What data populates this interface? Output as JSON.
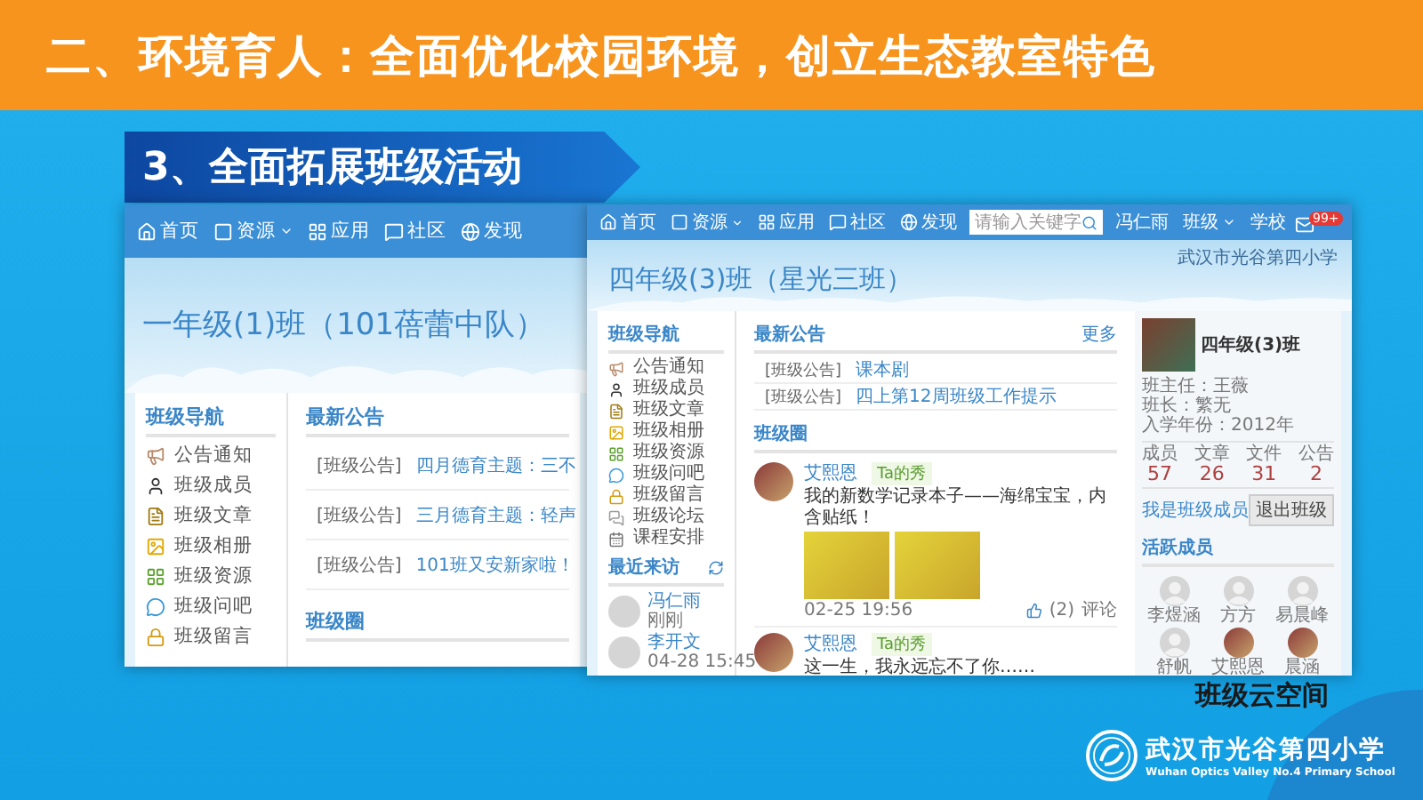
{
  "slide_title": "二、环境育人：全面优化校园环境，创立生态教室特色",
  "section_banner": "3、全面拓展班级活动",
  "left_window": {
    "nav": [
      {
        "kind": "home",
        "label": "首页",
        "dropdown": false
      },
      {
        "kind": "resource",
        "label": "资源",
        "dropdown": true
      },
      {
        "kind": "apps",
        "label": "应用",
        "dropdown": false
      },
      {
        "kind": "community",
        "label": "社区",
        "dropdown": false
      },
      {
        "kind": "discover",
        "label": "发现",
        "dropdown": false
      }
    ],
    "class_title": "一年级(1)班（101蓓蕾中队）",
    "nav_title": "班级导航",
    "nav_items": [
      {
        "kind": "notice",
        "label": "公告通知"
      },
      {
        "kind": "members",
        "label": "班级成员"
      },
      {
        "kind": "articles",
        "label": "班级文章"
      },
      {
        "kind": "album",
        "label": "班级相册"
      },
      {
        "kind": "resources",
        "label": "班级资源"
      },
      {
        "kind": "qa",
        "label": "班级问吧"
      },
      {
        "kind": "messages",
        "label": "班级留言"
      }
    ],
    "announcements_title": "最新公告",
    "announcements": [
      {
        "tag": "[班级公告]",
        "text": "四月德育主题：三不"
      },
      {
        "tag": "[班级公告]",
        "text": "三月德育主题：轻声"
      },
      {
        "tag": "[班级公告]",
        "text": "101班又安新家啦！"
      }
    ],
    "circle_title": "班级圈"
  },
  "right_window": {
    "nav": [
      {
        "kind": "home",
        "label": "首页",
        "dropdown": false
      },
      {
        "kind": "resource",
        "label": "资源",
        "dropdown": true
      },
      {
        "kind": "apps",
        "label": "应用",
        "dropdown": false
      },
      {
        "kind": "community",
        "label": "社区",
        "dropdown": false
      },
      {
        "kind": "discover",
        "label": "发现",
        "dropdown": false
      }
    ],
    "search": {
      "placeholder": "请输入关键字"
    },
    "user_links": [
      {
        "label": "冯仁雨",
        "dropdown": false
      },
      {
        "label": "班级",
        "dropdown": true
      },
      {
        "label": "学校",
        "dropdown": false
      }
    ],
    "mail_badge": "99+",
    "school_name": "武汉市光谷第四小学",
    "class_title": "四年级(3)班（星光三班）",
    "nav_title": "班级导航",
    "nav_items": [
      {
        "kind": "notice",
        "label": "公告通知"
      },
      {
        "kind": "members",
        "label": "班级成员"
      },
      {
        "kind": "articles",
        "label": "班级文章"
      },
      {
        "kind": "album",
        "label": "班级相册"
      },
      {
        "kind": "resources",
        "label": "班级资源"
      },
      {
        "kind": "qa",
        "label": "班级问吧"
      },
      {
        "kind": "messages",
        "label": "班级留言"
      },
      {
        "kind": "forum",
        "label": "班级论坛"
      },
      {
        "kind": "schedule",
        "label": "课程安排"
      }
    ],
    "visitors_title": "最近来访",
    "visitors": [
      {
        "name": "冯仁雨",
        "note": "刚刚"
      },
      {
        "name": "李开文",
        "note": "04-28 15:45"
      }
    ],
    "announcements_title": "最新公告",
    "more": "更多",
    "announcements": [
      {
        "tag": "[班级公告]",
        "text": "课本剧"
      },
      {
        "tag": "[班级公告]",
        "text": "四上第12周班级工作提示"
      }
    ],
    "circle_title": "班级圈",
    "posts": [
      {
        "kind": "photos",
        "author": "艾熙恩",
        "tag": "Ta的秀",
        "text": "我的新数学记录本子——海绵宝宝，内含贴纸！",
        "time": "02-25 19:56",
        "likes": "(2)",
        "comment": "评论"
      },
      {
        "kind": "text",
        "author": "艾熙恩",
        "tag": "Ta的秀",
        "text": "这一生，我永远忘不了你……"
      }
    ],
    "profile": {
      "name": "四年级(3)班",
      "lines": [
        "班主任：王薇",
        "班长：繁无",
        "入学年份：2012年"
      ]
    },
    "stats": [
      {
        "label": "成员",
        "value": "57"
      },
      {
        "label": "文章",
        "value": "26"
      },
      {
        "label": "文件",
        "value": "31"
      },
      {
        "label": "公告",
        "value": "2"
      }
    ],
    "member_link": "我是班级成员",
    "quit_button": "退出班级",
    "active_title": "活跃成员",
    "active_members": [
      {
        "kind": "default",
        "name": "李煜涵"
      },
      {
        "kind": "default",
        "name": "方方"
      },
      {
        "kind": "default",
        "name": "易晨峰"
      },
      {
        "kind": "default",
        "name": "舒帆"
      },
      {
        "kind": "photo",
        "name": "艾熙恩"
      },
      {
        "kind": "photo",
        "name": "晨涵"
      }
    ]
  },
  "caption": "班级云空间",
  "school_logo": {
    "name": "武汉市光谷第四小学",
    "english": "Wuhan Optics Valley No.4 Primary School"
  }
}
